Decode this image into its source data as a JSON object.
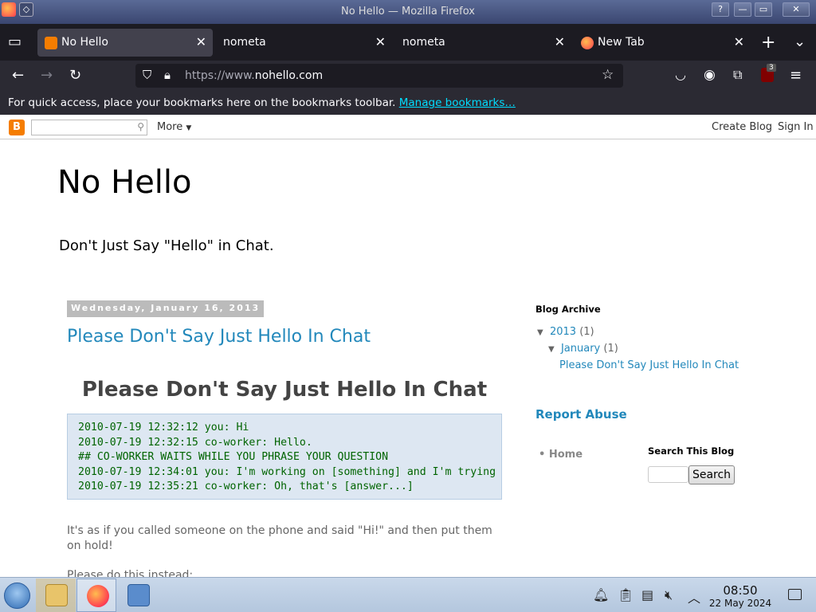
{
  "window": {
    "title": "No Hello — Mozilla Firefox",
    "buttons": {
      "help": "?",
      "minimize": "—",
      "maximize": "▭",
      "close": "✕"
    }
  },
  "tabs": [
    {
      "label": "No Hello",
      "active": true,
      "favicon": "blogger-icon"
    },
    {
      "label": "nometa",
      "active": false,
      "favicon": ""
    },
    {
      "label": "nometa",
      "active": false,
      "favicon": ""
    },
    {
      "label": "New Tab",
      "active": false,
      "favicon": "firefox-icon"
    }
  ],
  "navbar": {
    "url_prefix": "https://www.",
    "url_domain": "nohello.com",
    "extension_badge": "3"
  },
  "bookmarks_bar": {
    "message": "For quick access, place your bookmarks here on the bookmarks toolbar.",
    "link": "Manage bookmarks…"
  },
  "blogger_bar": {
    "more": "More",
    "create_blog": "Create Blog",
    "sign_in": "Sign In"
  },
  "blog": {
    "title": "No Hello",
    "description": "Don't Just Say \"Hello\" in Chat."
  },
  "post": {
    "date": "Wednesday, January 16, 2013",
    "title": "Please Don't Say Just Hello In Chat",
    "heading": "Please Don't Say Just Hello In Chat",
    "code_lines": [
      "2010-07-19 12:32:12 you: Hi",
      "2010-07-19 12:32:15 co-worker: Hello.",
      "## CO-WORKER WAITS WHILE YOU PHRASE YOUR QUESTION",
      "2010-07-19 12:34:01 you: I'm working on [something] and I'm trying",
      "2010-07-19 12:35:21 co-worker: Oh, that's [answer...]"
    ],
    "paragraph": "It's as if you called someone on the phone and said \"Hi!\" and then put them on hold!",
    "paragraph2": "Please do this instead:"
  },
  "sidebar": {
    "archive_heading": "Blog Archive",
    "year": "2013",
    "year_count": "(1)",
    "month": "January",
    "month_count": "(1)",
    "post_link": "Please Don't Say Just Hello In Chat",
    "report_abuse": "Report Abuse",
    "home": "Home",
    "search_heading": "Search This Blog",
    "search_button": "Search"
  },
  "taskbar": {
    "time": "08:50",
    "date": "22 May 2024"
  },
  "colors": {
    "link": "#2288bb",
    "browser_dark": "#1c1b22",
    "code_green": "#006400"
  }
}
